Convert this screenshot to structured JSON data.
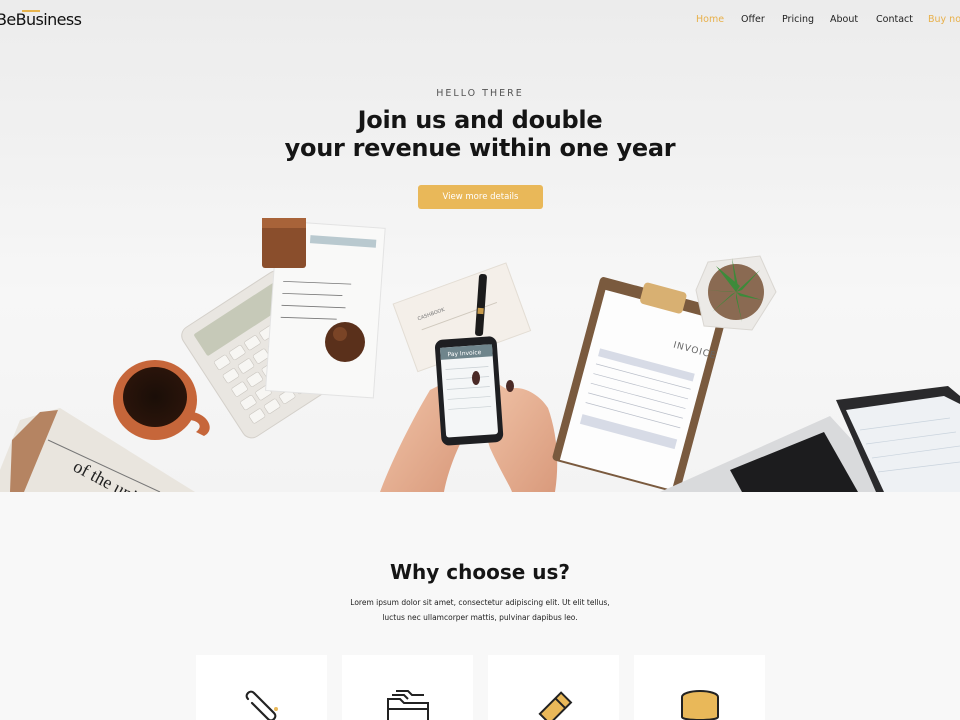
{
  "brand": {
    "name": "BeBusiness"
  },
  "nav": [
    {
      "label": "Home",
      "active": true
    },
    {
      "label": "Offer"
    },
    {
      "label": "Pricing"
    },
    {
      "label": "About"
    },
    {
      "label": "Contact"
    },
    {
      "label": "Buy now",
      "cta": true
    }
  ],
  "hero": {
    "eyebrow": "HELLO THERE",
    "headline_line1": "Join us and double",
    "headline_line2": "your revenue within one year",
    "button_label": "View more details",
    "phone_title": "Pay Invoice",
    "note_title": "CASHBOOK",
    "clipboard_title": "INVOICE",
    "newspaper_text": "of the union"
  },
  "why": {
    "title": "Why choose us?",
    "text_line1": "Lorem ipsum dolor sit amet, consectetur adipiscing elit. Ut elit tellus,",
    "text_line2": "luctus nec ullamcorper mattis, pulvinar dapibus leo."
  },
  "features": [
    {
      "icon": "paperclip-icon"
    },
    {
      "icon": "folders-icon"
    },
    {
      "icon": "pencil-icon"
    },
    {
      "icon": "coins-icon"
    }
  ],
  "colors": {
    "accent": "#e9b859",
    "text": "#151515",
    "background": "#f8f8f8"
  }
}
